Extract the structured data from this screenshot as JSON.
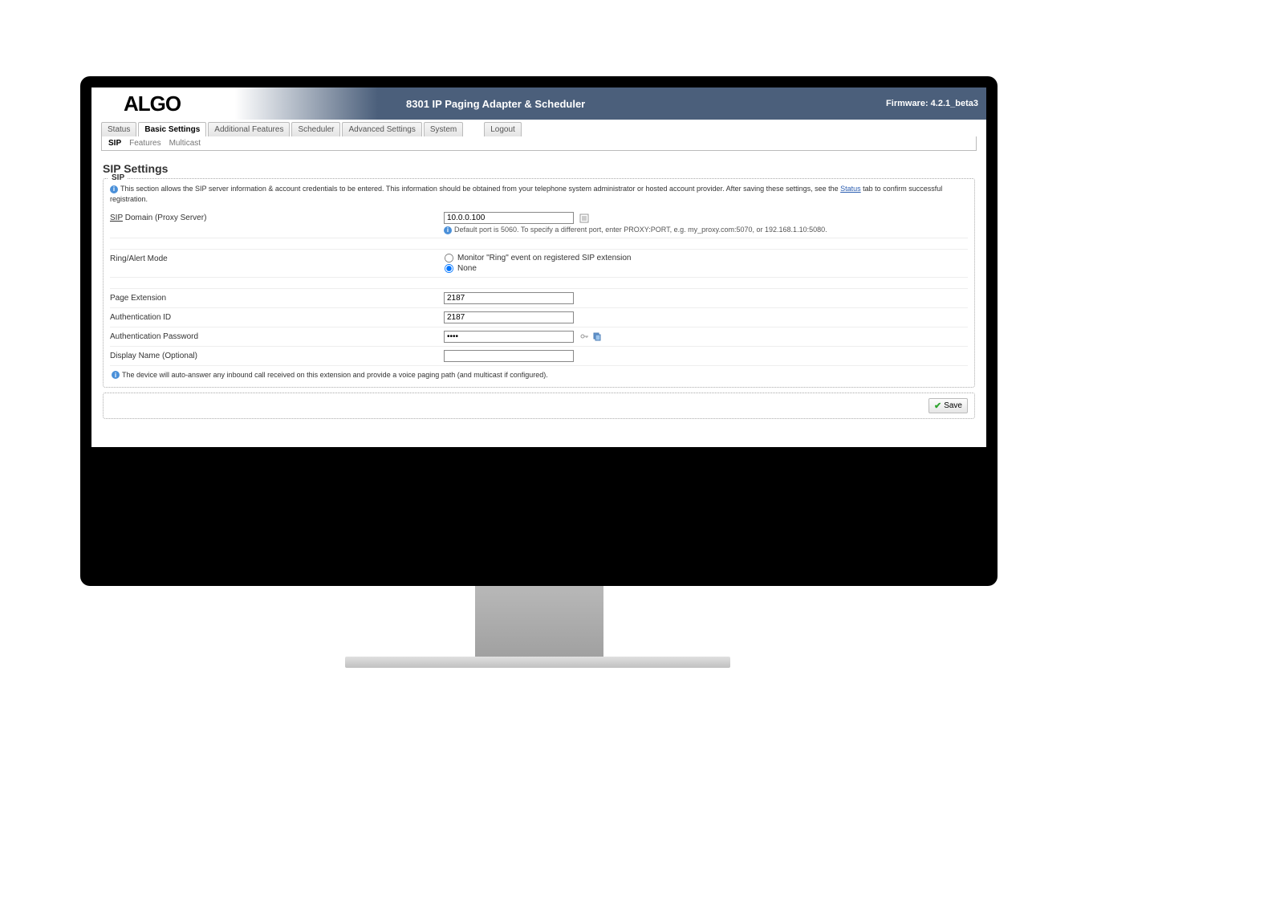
{
  "header": {
    "logo": "ALGO",
    "product": "8301 IP Paging Adapter & Scheduler",
    "firmware_label": "Firmware: 4.2.1_beta3"
  },
  "tabs": {
    "status": "Status",
    "basic": "Basic Settings",
    "additional": "Additional Features",
    "scheduler": "Scheduler",
    "advanced": "Advanced Settings",
    "system": "System",
    "logout": "Logout"
  },
  "subtabs": {
    "sip": "SIP",
    "features": "Features",
    "multicast": "Multicast"
  },
  "page": {
    "title": "SIP Settings",
    "legend": "SIP",
    "intro_pre": "This section allows the SIP server information & account credentials to be entered. This information should be obtained from your telephone system administrator or hosted account provider. After saving these settings, see the ",
    "intro_link": "Status",
    "intro_post": " tab to confirm successful registration."
  },
  "fields": {
    "domain_label_ul": "SIP",
    "domain_label_rest": " Domain (Proxy Server)",
    "domain_value": "10.0.0.100",
    "domain_hint": "Default port is 5060. To specify a different port, enter PROXY:PORT, e.g. my_proxy.com:5070, or 192.168.1.10:5080.",
    "ring_label": "Ring/Alert Mode",
    "ring_opt_monitor": "Monitor \"Ring\" event on registered SIP extension",
    "ring_opt_none": "None",
    "page_ext_label": "Page Extension",
    "page_ext_value": "2187",
    "auth_id_label": "Authentication ID",
    "auth_id_value": "2187",
    "auth_pw_label": "Authentication Password",
    "auth_pw_value": "••••",
    "display_label": "Display Name (Optional)",
    "display_value": "",
    "note": "The device will auto-answer any inbound call received on this extension and provide a voice paging path (and multicast if configured)."
  },
  "save": {
    "label": "Save"
  }
}
